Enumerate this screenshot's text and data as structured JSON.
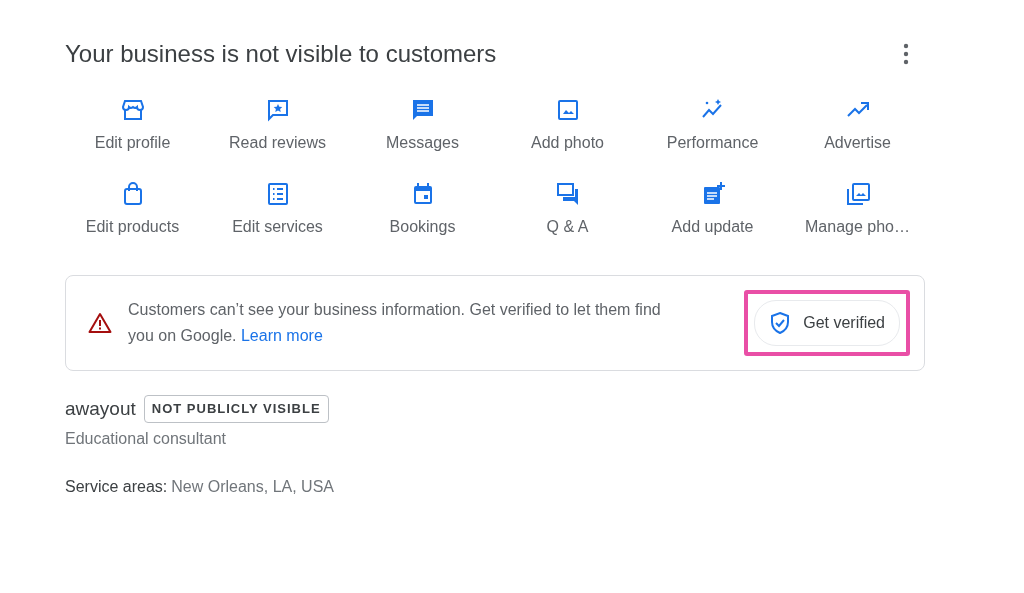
{
  "title": "Your business is not visible to customers",
  "actions": [
    {
      "label": "Edit profile"
    },
    {
      "label": "Read reviews"
    },
    {
      "label": "Messages"
    },
    {
      "label": "Add photo"
    },
    {
      "label": "Performance"
    },
    {
      "label": "Advertise"
    },
    {
      "label": "Edit products"
    },
    {
      "label": "Edit services"
    },
    {
      "label": "Bookings"
    },
    {
      "label": "Q & A"
    },
    {
      "label": "Add update"
    },
    {
      "label": "Manage pho…"
    }
  ],
  "alert": {
    "message": "Customers can’t see your business information. Get verified to let them find you on Google.",
    "link": "Learn more",
    "button": {
      "label": "Get verified",
      "highlighted": true
    }
  },
  "business": {
    "name": "awayout",
    "badge": "NOT PUBLICLY VISIBLE",
    "category": "Educational consultant",
    "service_areas_label": "Service areas:",
    "service_areas": "New Orleans, LA, USA"
  }
}
